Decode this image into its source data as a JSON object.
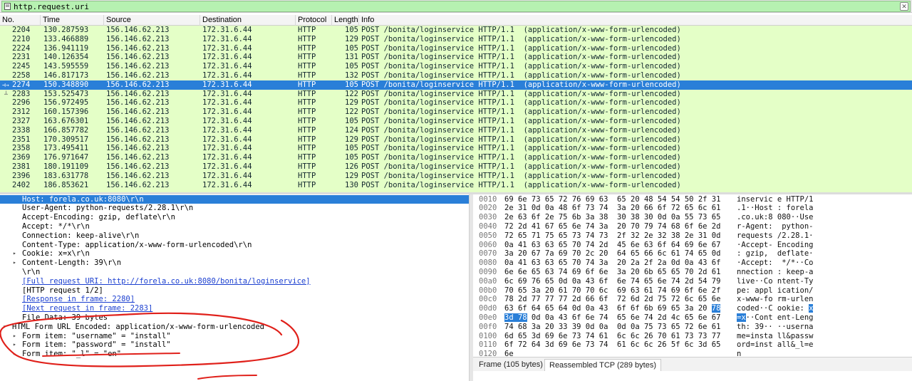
{
  "filter": {
    "value": "http.request.uri"
  },
  "columns": {
    "no": "No.",
    "time": "Time",
    "source": "Source",
    "destination": "Destination",
    "protocol": "Protocol",
    "length": "Length",
    "info": "Info"
  },
  "packets": [
    {
      "no": "2204",
      "time": "130.287593",
      "source": "156.146.62.213",
      "destination": "172.31.6.44",
      "protocol": "HTTP",
      "length": "105",
      "info": "POST /bonita/loginservice HTTP/1.1  (application/x-www-form-urlencoded)"
    },
    {
      "no": "2210",
      "time": "133.466889",
      "source": "156.146.62.213",
      "destination": "172.31.6.44",
      "protocol": "HTTP",
      "length": "129",
      "info": "POST /bonita/loginservice HTTP/1.1  (application/x-www-form-urlencoded)"
    },
    {
      "no": "2224",
      "time": "136.941119",
      "source": "156.146.62.213",
      "destination": "172.31.6.44",
      "protocol": "HTTP",
      "length": "105",
      "info": "POST /bonita/loginservice HTTP/1.1  (application/x-www-form-urlencoded)"
    },
    {
      "no": "2231",
      "time": "140.126354",
      "source": "156.146.62.213",
      "destination": "172.31.6.44",
      "protocol": "HTTP",
      "length": "131",
      "info": "POST /bonita/loginservice HTTP/1.1  (application/x-www-form-urlencoded)"
    },
    {
      "no": "2245",
      "time": "143.595559",
      "source": "156.146.62.213",
      "destination": "172.31.6.44",
      "protocol": "HTTP",
      "length": "105",
      "info": "POST /bonita/loginservice HTTP/1.1  (application/x-www-form-urlencoded)"
    },
    {
      "no": "2258",
      "time": "146.817173",
      "source": "156.146.62.213",
      "destination": "172.31.6.44",
      "protocol": "HTTP",
      "length": "132",
      "info": "POST /bonita/loginservice HTTP/1.1  (application/x-www-form-urlencoded)"
    },
    {
      "no": "2274",
      "time": "150.348890",
      "source": "156.146.62.213",
      "destination": "172.31.6.44",
      "protocol": "HTTP",
      "length": "105",
      "info": "POST /bonita/loginservice HTTP/1.1  (application/x-www-form-urlencoded)",
      "selected": true
    },
    {
      "no": "2283",
      "time": "153.525473",
      "source": "156.146.62.213",
      "destination": "172.31.6.44",
      "protocol": "HTTP",
      "length": "122",
      "info": "POST /bonita/loginservice HTTP/1.1  (application/x-www-form-urlencoded)"
    },
    {
      "no": "2296",
      "time": "156.972495",
      "source": "156.146.62.213",
      "destination": "172.31.6.44",
      "protocol": "HTTP",
      "length": "129",
      "info": "POST /bonita/loginservice HTTP/1.1  (application/x-www-form-urlencoded)"
    },
    {
      "no": "2312",
      "time": "160.157396",
      "source": "156.146.62.213",
      "destination": "172.31.6.44",
      "protocol": "HTTP",
      "length": "122",
      "info": "POST /bonita/loginservice HTTP/1.1  (application/x-www-form-urlencoded)"
    },
    {
      "no": "2327",
      "time": "163.676301",
      "source": "156.146.62.213",
      "destination": "172.31.6.44",
      "protocol": "HTTP",
      "length": "105",
      "info": "POST /bonita/loginservice HTTP/1.1  (application/x-www-form-urlencoded)"
    },
    {
      "no": "2338",
      "time": "166.857782",
      "source": "156.146.62.213",
      "destination": "172.31.6.44",
      "protocol": "HTTP",
      "length": "124",
      "info": "POST /bonita/loginservice HTTP/1.1  (application/x-www-form-urlencoded)"
    },
    {
      "no": "2351",
      "time": "170.309517",
      "source": "156.146.62.213",
      "destination": "172.31.6.44",
      "protocol": "HTTP",
      "length": "129",
      "info": "POST /bonita/loginservice HTTP/1.1  (application/x-www-form-urlencoded)"
    },
    {
      "no": "2358",
      "time": "173.495411",
      "source": "156.146.62.213",
      "destination": "172.31.6.44",
      "protocol": "HTTP",
      "length": "105",
      "info": "POST /bonita/loginservice HTTP/1.1  (application/x-www-form-urlencoded)"
    },
    {
      "no": "2369",
      "time": "176.971647",
      "source": "156.146.62.213",
      "destination": "172.31.6.44",
      "protocol": "HTTP",
      "length": "105",
      "info": "POST /bonita/loginservice HTTP/1.1  (application/x-www-form-urlencoded)"
    },
    {
      "no": "2381",
      "time": "180.191109",
      "source": "156.146.62.213",
      "destination": "172.31.6.44",
      "protocol": "HTTP",
      "length": "126",
      "info": "POST /bonita/loginservice HTTP/1.1  (application/x-www-form-urlencoded)"
    },
    {
      "no": "2396",
      "time": "183.631778",
      "source": "156.146.62.213",
      "destination": "172.31.6.44",
      "protocol": "HTTP",
      "length": "129",
      "info": "POST /bonita/loginservice HTTP/1.1  (application/x-www-form-urlencoded)"
    },
    {
      "no": "2402",
      "time": "186.853621",
      "source": "156.146.62.213",
      "destination": "172.31.6.44",
      "protocol": "HTTP",
      "length": "130",
      "info": "POST /bonita/loginservice HTTP/1.1  (application/x-www-form-urlencoded)"
    }
  ],
  "details": [
    {
      "text": "Host: forela.co.uk:8080\\r\\n",
      "indent": 2,
      "selected": true
    },
    {
      "text": "User-Agent: python-requests/2.28.1\\r\\n",
      "indent": 2
    },
    {
      "text": "Accept-Encoding: gzip, deflate\\r\\n",
      "indent": 2
    },
    {
      "text": "Accept: */*\\r\\n",
      "indent": 2
    },
    {
      "text": "Connection: keep-alive\\r\\n",
      "indent": 2
    },
    {
      "text": "Content-Type: application/x-www-form-urlencoded\\r\\n",
      "indent": 2
    },
    {
      "text": "Cookie: x=x\\r\\n",
      "indent": 2,
      "expander": "closed"
    },
    {
      "text": "Content-Length: 39\\r\\n",
      "indent": 2,
      "expander": "closed"
    },
    {
      "text": "\\r\\n",
      "indent": 2
    },
    {
      "text": "[Full request URI: http://forela.co.uk:8080/bonita/loginservice]",
      "indent": 2,
      "link": true
    },
    {
      "text": "[HTTP request 1/2]",
      "indent": 2
    },
    {
      "text": "[Response in frame: 2280]",
      "indent": 2,
      "link": true
    },
    {
      "text": "[Next request in frame: 2283]",
      "indent": 2,
      "link": true
    },
    {
      "text": "File Data: 39 bytes",
      "indent": 2
    },
    {
      "text": "HTML Form URL Encoded: application/x-www-form-urlencoded",
      "indent": 1,
      "expander": "open"
    },
    {
      "text": "Form item: \"username\" = \"install\"",
      "indent": 2,
      "expander": "closed"
    },
    {
      "text": "Form item: \"password\" = \"install\"",
      "indent": 2,
      "expander": "closed"
    },
    {
      "text": "Form item: \"_l\" = \"en\"",
      "indent": 2,
      "expander": "closed"
    }
  ],
  "hex": [
    {
      "off": "0010",
      "bytes": "69 6e 73 65 72 76 69 63  65 20 48 54 54 50 2f 31",
      "ascii": "inservic e HTTP/1"
    },
    {
      "off": "0020",
      "bytes": "2e 31 0d 0a 48 6f 73 74  3a 20 66 6f 72 65 6c 61",
      "ascii": ".1··Host : forela"
    },
    {
      "off": "0030",
      "bytes": "2e 63 6f 2e 75 6b 3a 38  30 38 30 0d 0a 55 73 65",
      "ascii": ".co.uk:8 080··Use"
    },
    {
      "off": "0040",
      "bytes": "72 2d 41 67 65 6e 74 3a  20 70 79 74 68 6f 6e 2d",
      "ascii": "r-Agent:  python-"
    },
    {
      "off": "0050",
      "bytes": "72 65 71 75 65 73 74 73  2f 32 2e 32 38 2e 31 0d",
      "ascii": "requests /2.28.1·"
    },
    {
      "off": "0060",
      "bytes": "0a 41 63 63 65 70 74 2d  45 6e 63 6f 64 69 6e 67",
      "ascii": "·Accept- Encoding"
    },
    {
      "off": "0070",
      "bytes": "3a 20 67 7a 69 70 2c 20  64 65 66 6c 61 74 65 0d",
      "ascii": ": gzip,  deflate·"
    },
    {
      "off": "0080",
      "bytes": "0a 41 63 63 65 70 74 3a  20 2a 2f 2a 0d 0a 43 6f",
      "ascii": "·Accept:  */*··Co"
    },
    {
      "off": "0090",
      "bytes": "6e 6e 65 63 74 69 6f 6e  3a 20 6b 65 65 70 2d 61",
      "ascii": "nnection : keep-a"
    },
    {
      "off": "00a0",
      "bytes": "6c 69 76 65 0d 0a 43 6f  6e 74 65 6e 74 2d 54 79",
      "ascii": "live··Co ntent-Ty"
    },
    {
      "off": "00b0",
      "bytes": "70 65 3a 20 61 70 70 6c  69 63 61 74 69 6f 6e 2f",
      "ascii": "pe: appl ication/"
    },
    {
      "off": "00c0",
      "bytes": "78 2d 77 77 77 2d 66 6f  72 6d 2d 75 72 6c 65 6e",
      "ascii": "x-www-fo rm-urlen"
    },
    {
      "off": "00d0",
      "bytes": "63 6f 64 65 64 0d 0a 43  6f 6f 6b 69 65 3a 20 ",
      "bytesHl": "78",
      "ascii": "coded··C ookie: ",
      "asciiHl": "x"
    },
    {
      "off": "00e0",
      "bytesHlPre": "3d 78",
      "bytes": " 0d 0a 43 6f 6e 74  65 6e 74 2d 4c 65 6e 67",
      "asciiHlPre": "=x",
      "ascii": "··Cont ent-Leng"
    },
    {
      "off": "00f0",
      "bytes": "74 68 3a 20 33 39 0d 0a  0d 0a 75 73 65 72 6e 61",
      "ascii": "th: 39·· ··userna"
    },
    {
      "off": "0100",
      "bytes": "6d 65 3d 69 6e 73 74 61  6c 6c 26 70 61 73 73 77",
      "ascii": "me=insta ll&passw"
    },
    {
      "off": "0110",
      "bytes": "6f 72 64 3d 69 6e 73 74  61 6c 6c 26 5f 6c 3d 65",
      "ascii": "ord=inst all&_l=e"
    },
    {
      "off": "0120",
      "bytes": "6e",
      "ascii": "n"
    }
  ],
  "tabs": {
    "frame": "Frame (105 bytes)",
    "reassembled": "Reassembled TCP (289 bytes)"
  },
  "colors": {
    "filter_ok": "#b6f1b1",
    "http_row": "#e4ffc7",
    "selected": "#2a7fd8",
    "annotation": "#e0201a"
  }
}
